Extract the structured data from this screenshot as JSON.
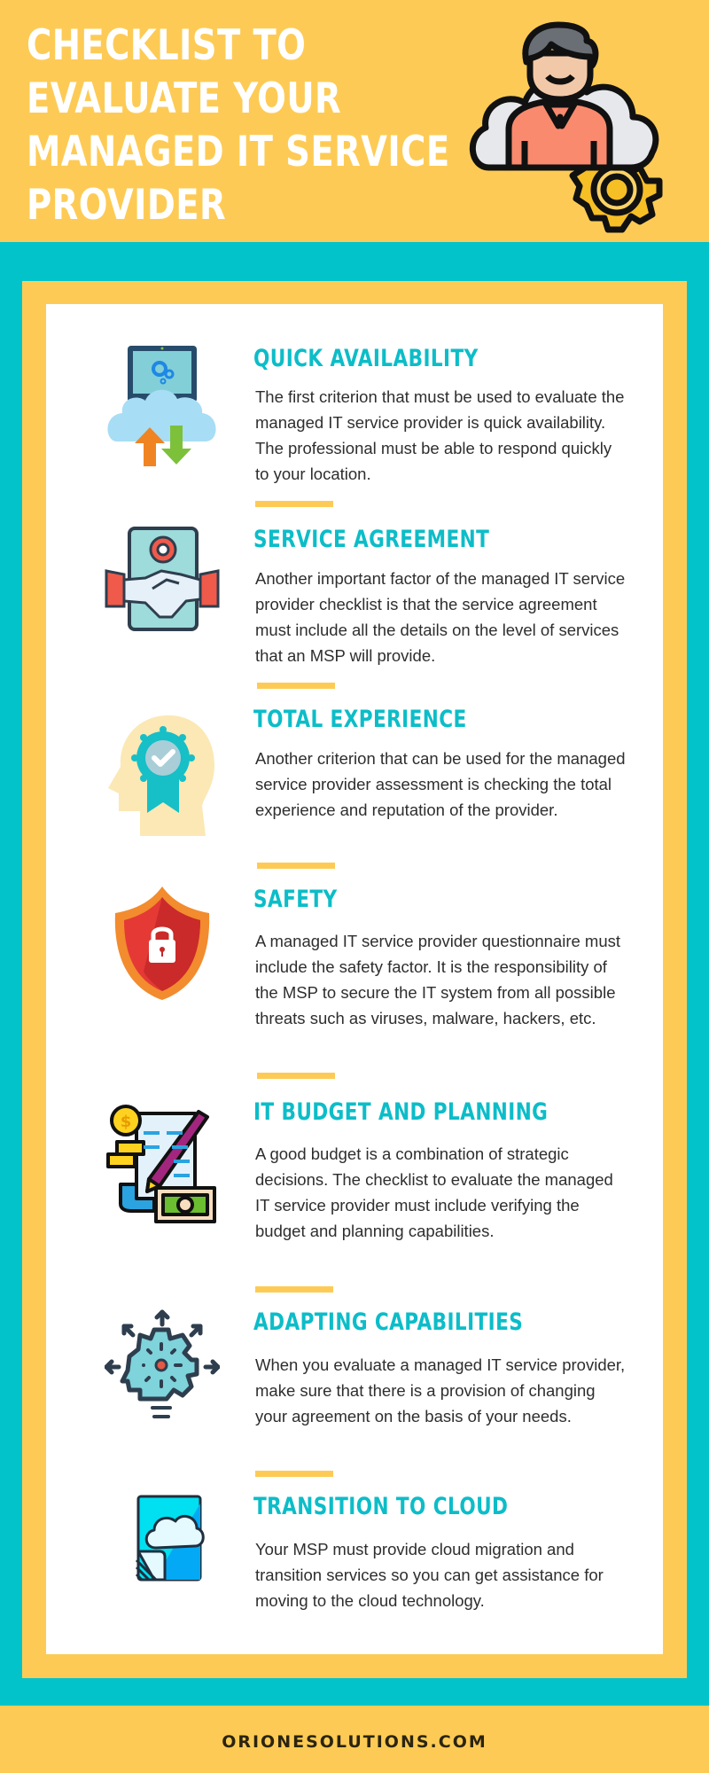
{
  "header": {
    "title_lines": [
      "CHECKLIST TO",
      "EVALUATE YOUR",
      "MANAGED IT SERVICE",
      "PROVIDER"
    ],
    "illustration": "person-cloud-gear-icon"
  },
  "colors": {
    "yellow": "#FDCB55",
    "teal": "#02C3CA",
    "heading_teal": "#0CBDC8",
    "body_text": "#2e2e2e",
    "white": "#ffffff"
  },
  "sections": [
    {
      "icon": "laptop-cloud-sync-icon",
      "heading": "QUICK AVAILABILITY",
      "body": "The first criterion that must be used to evaluate the managed IT service provider is quick availability. The professional must be able to respond quickly to your location."
    },
    {
      "icon": "handshake-agreement-icon",
      "heading": "SERVICE AGREEMENT",
      "body": "Another important factor of the managed IT service provider checklist is that the service agreement must include all the details on the level of services that an MSP will provide."
    },
    {
      "icon": "head-award-badge-icon",
      "heading": "TOTAL EXPERIENCE",
      "body": "Another criterion that can be used for the managed service provider assessment is checking the total experience and reputation of the provider."
    },
    {
      "icon": "shield-lock-icon",
      "heading": "SAFETY",
      "body": "A managed IT service provider questionnaire must include the safety factor. It is the responsibility of the MSP to secure the IT system from all possible threats such as viruses, malware, hackers, etc."
    },
    {
      "icon": "budget-planning-icon",
      "heading": "IT BUDGET AND PLANNING",
      "body": "A good budget is a combination of strategic decisions. The checklist to evaluate the managed IT service provider must include verifying the budget and planning capabilities."
    },
    {
      "icon": "gear-head-arrows-icon",
      "heading": "ADAPTING CAPABILITIES",
      "body": "When you evaluate a managed IT service provider, make sure that there is a provision of changing your agreement on the basis of your needs."
    },
    {
      "icon": "cloud-document-icon",
      "heading": "TRANSITION TO CLOUD",
      "body": "Your MSP must provide cloud migration and transition services so you can get assistance for moving to the cloud technology."
    }
  ],
  "footer": {
    "website": "ORIONESOLUTIONS.COM"
  }
}
